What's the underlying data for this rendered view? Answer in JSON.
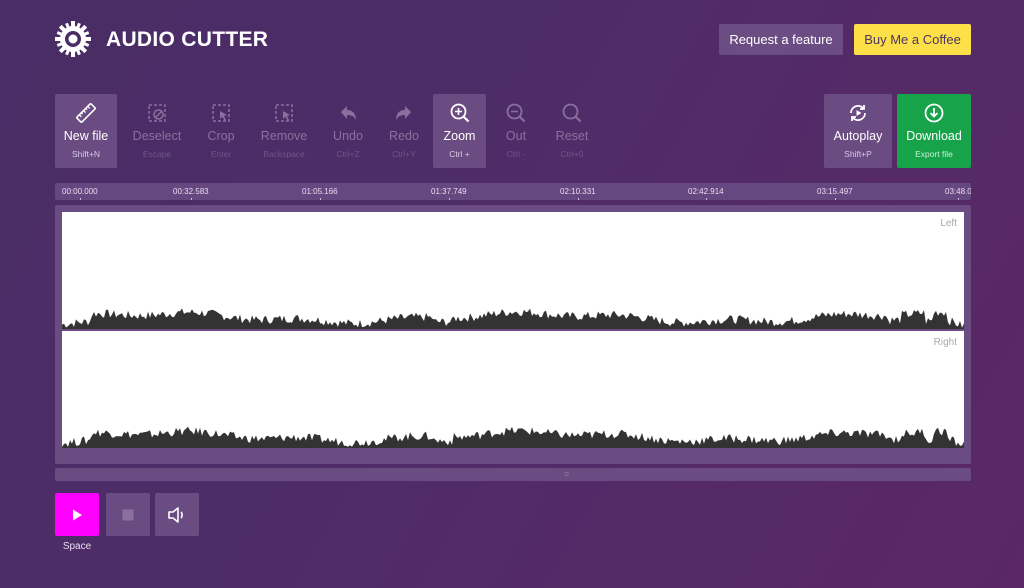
{
  "header": {
    "app_title": "AUDIO CUTTER",
    "logo_icon": "gear-logo-icon",
    "request_label": "Request a feature",
    "coffee_label": "Buy Me a Coffee"
  },
  "toolbar": {
    "new_file": {
      "label": "New file",
      "shortcut": "Shift+N",
      "icon": "ruler-icon",
      "enabled": true
    },
    "deselect": {
      "label": "Deselect",
      "shortcut": "Escape",
      "icon": "deselect-icon",
      "enabled": false
    },
    "crop": {
      "label": "Crop",
      "shortcut": "Enter",
      "icon": "crop-icon",
      "enabled": false
    },
    "remove": {
      "label": "Remove",
      "shortcut": "Backspace",
      "icon": "remove-icon",
      "enabled": false
    },
    "undo": {
      "label": "Undo",
      "shortcut": "Ctrl+Z",
      "icon": "undo-icon",
      "enabled": false
    },
    "redo": {
      "label": "Redo",
      "shortcut": "Ctrl+Y",
      "icon": "redo-icon",
      "enabled": false
    },
    "zoom_in": {
      "label": "Zoom",
      "shortcut": "Ctrl +",
      "icon": "zoom-in-icon",
      "enabled": true
    },
    "zoom_out": {
      "label": "Out",
      "shortcut": "Ctrl -",
      "icon": "zoom-out-icon",
      "enabled": false
    },
    "reset": {
      "label": "Reset",
      "shortcut": "Ctrl+0",
      "icon": "zoom-reset-icon",
      "enabled": false
    },
    "autoplay": {
      "label": "Autoplay",
      "shortcut": "Shift+P",
      "icon": "autoplay-icon",
      "enabled": true
    },
    "download": {
      "label": "Download",
      "shortcut": "Export file",
      "icon": "download-icon",
      "enabled": true
    }
  },
  "timeline": {
    "ticks": [
      "00:00.000",
      "00:32.583",
      "01:05.166",
      "01:37.749",
      "02:10.331",
      "02:42.914",
      "03:15.497",
      "03:48.0"
    ]
  },
  "waveform": {
    "left_label": "Left",
    "right_label": "Right"
  },
  "player": {
    "play_icon": "play-icon",
    "stop_icon": "stop-icon",
    "volume_icon": "volume-icon",
    "play_shortcut": "Space"
  },
  "colors": {
    "background": "#4f2c68",
    "panel": "#6a4c82",
    "play_button": "#ff00ff",
    "coffee_button": "#fde047",
    "download_button": "#16a34a",
    "waveform": "#333333"
  }
}
